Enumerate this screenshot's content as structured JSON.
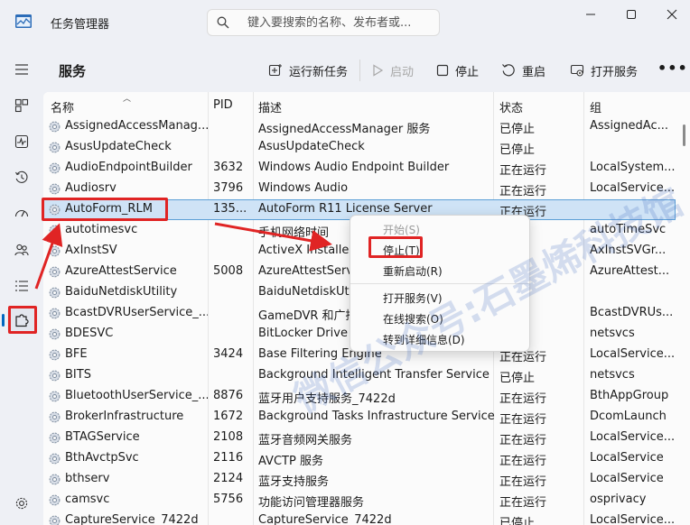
{
  "app": {
    "title": "任务管理器"
  },
  "search": {
    "placeholder": "键入要搜索的名称、发布者或..."
  },
  "page": {
    "title": "服务"
  },
  "toolbar": {
    "new_task": "运行新任务",
    "start": "启动",
    "stop": "停止",
    "restart": "重启",
    "open_services": "打开服务",
    "more": "•••"
  },
  "columns": {
    "name": "名称",
    "pid": "PID",
    "desc": "描述",
    "status": "状态",
    "group": "组"
  },
  "rows": [
    {
      "name": "AssignedAccessManag...",
      "pid": "",
      "desc": "AssignedAccessManager 服务",
      "status": "已停止",
      "group": "AssignedAc..."
    },
    {
      "name": "AsusUpdateCheck",
      "pid": "",
      "desc": "AsusUpdateCheck",
      "status": "已停止",
      "group": ""
    },
    {
      "name": "AudioEndpointBuilder",
      "pid": "3632",
      "desc": "Windows Audio Endpoint Builder",
      "status": "正在运行",
      "group": "LocalSystem..."
    },
    {
      "name": "Audiosrv",
      "pid": "3796",
      "desc": "Windows Audio",
      "status": "正在运行",
      "group": "LocalService..."
    },
    {
      "name": "AutoForm_RLM",
      "pid": "135...",
      "desc": "AutoForm R11 License Server",
      "status": "正在运行",
      "group": ""
    },
    {
      "name": "autotimesvc",
      "pid": "",
      "desc": "手机网络时间",
      "status": "",
      "group": "autoTimeSvc"
    },
    {
      "name": "AxInstSV",
      "pid": "",
      "desc": "ActiveX Installer",
      "status": "",
      "group": "AxInstSVGr..."
    },
    {
      "name": "AzureAttestService",
      "pid": "5008",
      "desc": "AzureAttestServ",
      "status": "行",
      "group": "AzureAttest..."
    },
    {
      "name": "BaiduNetdiskUtility",
      "pid": "",
      "desc": "BaiduNetdiskUti",
      "status": "",
      "group": ""
    },
    {
      "name": "BcastDVRUserService_...",
      "pid": "",
      "desc": "GameDVR 和广播",
      "status": "",
      "group": "BcastDVRUs..."
    },
    {
      "name": "BDESVC",
      "pid": "",
      "desc": "BitLocker Drive E",
      "status": "",
      "group": "netsvcs"
    },
    {
      "name": "BFE",
      "pid": "3424",
      "desc": "Base Filtering Engine",
      "status": "正在运行",
      "group": "LocalService..."
    },
    {
      "name": "BITS",
      "pid": "",
      "desc": "Background Intelligent Transfer Service",
      "status": "已停止",
      "group": "netsvcs"
    },
    {
      "name": "BluetoothUserService_...",
      "pid": "8876",
      "desc": "蓝牙用户支持服务_7422d",
      "status": "正在运行",
      "group": "BthAppGroup"
    },
    {
      "name": "BrokerInfrastructure",
      "pid": "1672",
      "desc": "Background Tasks Infrastructure Service",
      "status": "正在运行",
      "group": "DcomLaunch"
    },
    {
      "name": "BTAGService",
      "pid": "2108",
      "desc": "蓝牙音频网关服务",
      "status": "正在运行",
      "group": "LocalService..."
    },
    {
      "name": "BthAvctpSvc",
      "pid": "2116",
      "desc": "AVCTP 服务",
      "status": "正在运行",
      "group": "LocalService"
    },
    {
      "name": "bthserv",
      "pid": "2124",
      "desc": "蓝牙支持服务",
      "status": "正在运行",
      "group": "LocalService"
    },
    {
      "name": "camsvc",
      "pid": "5756",
      "desc": "功能访问管理器服务",
      "status": "正在运行",
      "group": "osprivacy"
    },
    {
      "name": "CaptureService_7422d",
      "pid": "",
      "desc": "CaptureService_7422d",
      "status": "已停止",
      "group": "LocalService..."
    }
  ],
  "menu": {
    "start": "开始(S)",
    "stop": "停止(T)",
    "restart": "重新启动(R)",
    "open_services": "打开服务(V)",
    "search_online": "在线搜索(O)",
    "goto_details": "转到详细信息(D)"
  },
  "watermark": {
    "text": "微信公众号:石墨烯科技馆"
  },
  "colors": {
    "highlight": "#e02424",
    "selected_row": "#cfe3f6",
    "accent": "#0067c0"
  }
}
